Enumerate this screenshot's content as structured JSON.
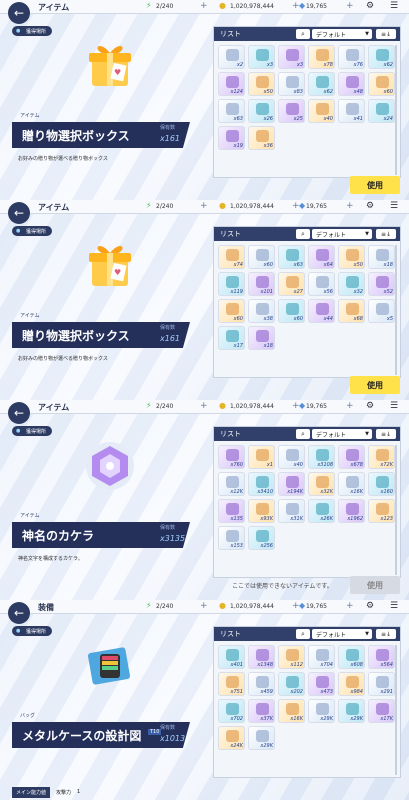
{
  "colors": {
    "navy": "#2d3b63",
    "use_yellow": "#ffe24a"
  },
  "panels": [
    {
      "title": "アイテム",
      "slots": "2/240",
      "gold": "1,020,978,444",
      "gems": "19,765",
      "where": "獲得場所",
      "category": "アイテム",
      "name": "贈り物選択ボックス",
      "own_label": "保有数",
      "count": "x161",
      "desc": "お好みの贈り物が選べる贈り物ボックス",
      "list": "リスト",
      "sort": "デフォルト",
      "use": "使用",
      "note": "",
      "items": [
        "x2",
        "x3",
        "x3",
        "x78",
        "x76",
        "x62",
        "x124",
        "x50",
        "x83",
        "x62",
        "x48",
        "x60",
        "x63",
        "x26",
        "x25",
        "x40",
        "x41",
        "x24",
        "x19",
        "x36"
      ]
    },
    {
      "title": "アイテム",
      "slots": "2/240",
      "gold": "1,020,978,444",
      "gems": "19,765",
      "where": "獲得場所",
      "category": "アイテム",
      "name": "贈り物選択ボックス",
      "own_label": "保有数",
      "count": "x161",
      "desc": "お好みの贈り物が選べる贈り物ボックス",
      "list": "リスト",
      "sort": "デフォルト",
      "use": "使用",
      "note": "",
      "items": [
        "x74",
        "x60",
        "x63",
        "x64",
        "x50",
        "x18",
        "x119",
        "x101",
        "x27",
        "x56",
        "x32",
        "x52",
        "x60",
        "x38",
        "x60",
        "x44",
        "x68",
        "x5",
        "x17",
        "x18"
      ]
    },
    {
      "title": "アイテム",
      "slots": "2/240",
      "gold": "1,020,978,444",
      "gems": "19,765",
      "where": "獲得場所",
      "category": "アイテム",
      "name": "神名のカケラ",
      "own_label": "保有数",
      "count": "x3135",
      "desc": "神名文字を構成するカケラ。",
      "list": "リスト",
      "sort": "デフォルト",
      "use": "使用",
      "note": "ここでは使用できないアイテムです。",
      "items": [
        "x760",
        "x1",
        "x40",
        "x3108",
        "x678",
        "x72K",
        "x12K",
        "x3410",
        "x194K",
        "x32K",
        "x16K",
        "x160",
        "x135",
        "x93K",
        "x31K",
        "x26K",
        "x1962",
        "x123",
        "x153",
        "x256"
      ]
    },
    {
      "title": "装備",
      "slots": "2/240",
      "gold": "1,020,978,444",
      "gems": "19,765",
      "where": "獲得場所",
      "category": "バッグ",
      "name": "メタルケースの設計図",
      "own_label": "保有数",
      "count": "x1013",
      "tier": "T10",
      "desc": "",
      "list": "リスト",
      "sort": "デフォルト",
      "stat_key": "メイン能力値",
      "stat_name": "攻撃力",
      "stat_val": "1",
      "items": [
        "x401",
        "x1348",
        "x112",
        "x704",
        "x608",
        "x564",
        "x751",
        "x459",
        "x202",
        "x473",
        "x984",
        "x291",
        "x702",
        "x37K",
        "x16K",
        "x29K",
        "x29K",
        "x17K",
        "x24K",
        "x29K"
      ]
    }
  ]
}
